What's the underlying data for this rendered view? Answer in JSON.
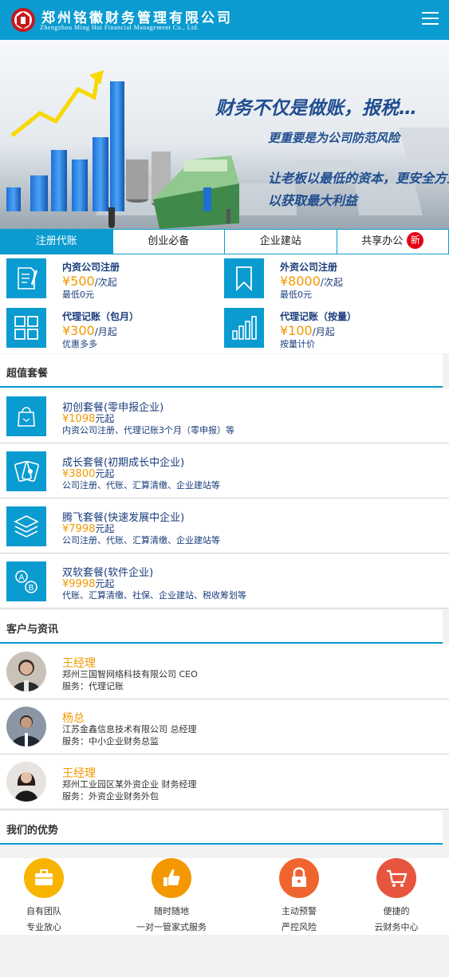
{
  "header": {
    "brand_cn": "郑州铭徽财务管理有限公司",
    "brand_en": "Zhengzhou Ming Hui Financial Management Co., Ltd.",
    "menu_icon": "hamburger-menu-icon",
    "bg_color": "#0a9bd0"
  },
  "banner": {
    "headline": "财务不仅是做账，报税…",
    "line2": "更重要是为公司防范风险",
    "line3": "让老板以最低的资本，更安全方式，",
    "line4": "以获取最大利益"
  },
  "tabs": [
    {
      "label": "注册代账"
    },
    {
      "label": "创业必备"
    },
    {
      "label": "企业建站"
    },
    {
      "label": "共享办公",
      "badge": "新"
    }
  ],
  "services": [
    {
      "title": "内资公司注册",
      "price": "¥500",
      "unit": "/次起",
      "sub": "最低0元",
      "icon": "document-pen-icon"
    },
    {
      "title": "外资公司注册",
      "price": "¥8000",
      "unit": "/次起",
      "sub": "最低0元",
      "icon": "bookmark-icon"
    },
    {
      "title": "代理记账（包月）",
      "price": "¥300",
      "unit": "/月起",
      "sub": "优惠多多",
      "icon": "grid-icon"
    },
    {
      "title": "代理记账（按量）",
      "price": "¥100",
      "unit": "/月起",
      "sub": "按量计价",
      "icon": "bar-chart-icon"
    }
  ],
  "sections": {
    "packages": "超值套餐",
    "customers": "客户与资讯",
    "advantages": "我们的优势"
  },
  "packages": [
    {
      "title": "初创套餐(零申报企业)",
      "price": "¥1098",
      "unit": "元起",
      "desc": "内资公司注册、代理记账3个月（零申报）等",
      "icon": "bag-icon"
    },
    {
      "title": "成长套餐(初期成长中企业)",
      "price": "¥3800",
      "unit": "元起",
      "desc": "公司注册、代账、汇算清缴、企业建站等",
      "icon": "cards-icon"
    },
    {
      "title": "腾飞套餐(快速发展中企业)",
      "price": "¥7998",
      "unit": "元起",
      "desc": "公司注册、代账、汇算清缴、企业建站等",
      "icon": "layers-icon"
    },
    {
      "title": "双软套餐(软件企业)",
      "price": "¥9998",
      "unit": "元起",
      "desc": "代账、汇算清缴、社保、企业建站、税收筹划等",
      "icon": "ab-icon"
    }
  ],
  "customers": [
    {
      "name": "王经理",
      "company": "郑州三国智网络科技有限公司   CEO",
      "service": "服务：代理记账"
    },
    {
      "name": "杨总",
      "company": "江苏金鑫信息技术有限公司   总经理",
      "service": "服务：中小企业财务总监"
    },
    {
      "name": "王经理",
      "company": "郑州工业园区某外资企业   财务经理",
      "service": "服务：外资企业财务外包"
    }
  ],
  "advantages": [
    {
      "line1": "自有团队",
      "line2": "专业放心",
      "icon": "briefcase-icon",
      "color": "#f7b500"
    },
    {
      "line1": "随时随地",
      "line2": "一对一管家式服务",
      "icon": "thumbs-up-icon",
      "color": "#f39800"
    },
    {
      "line1": "主动预警",
      "line2": "严控风险",
      "icon": "lock-icon",
      "color": "#f0652f"
    },
    {
      "line1": "便捷的",
      "line2": "云财务中心",
      "icon": "shopping-cart-icon",
      "color": "#e8553e"
    }
  ]
}
